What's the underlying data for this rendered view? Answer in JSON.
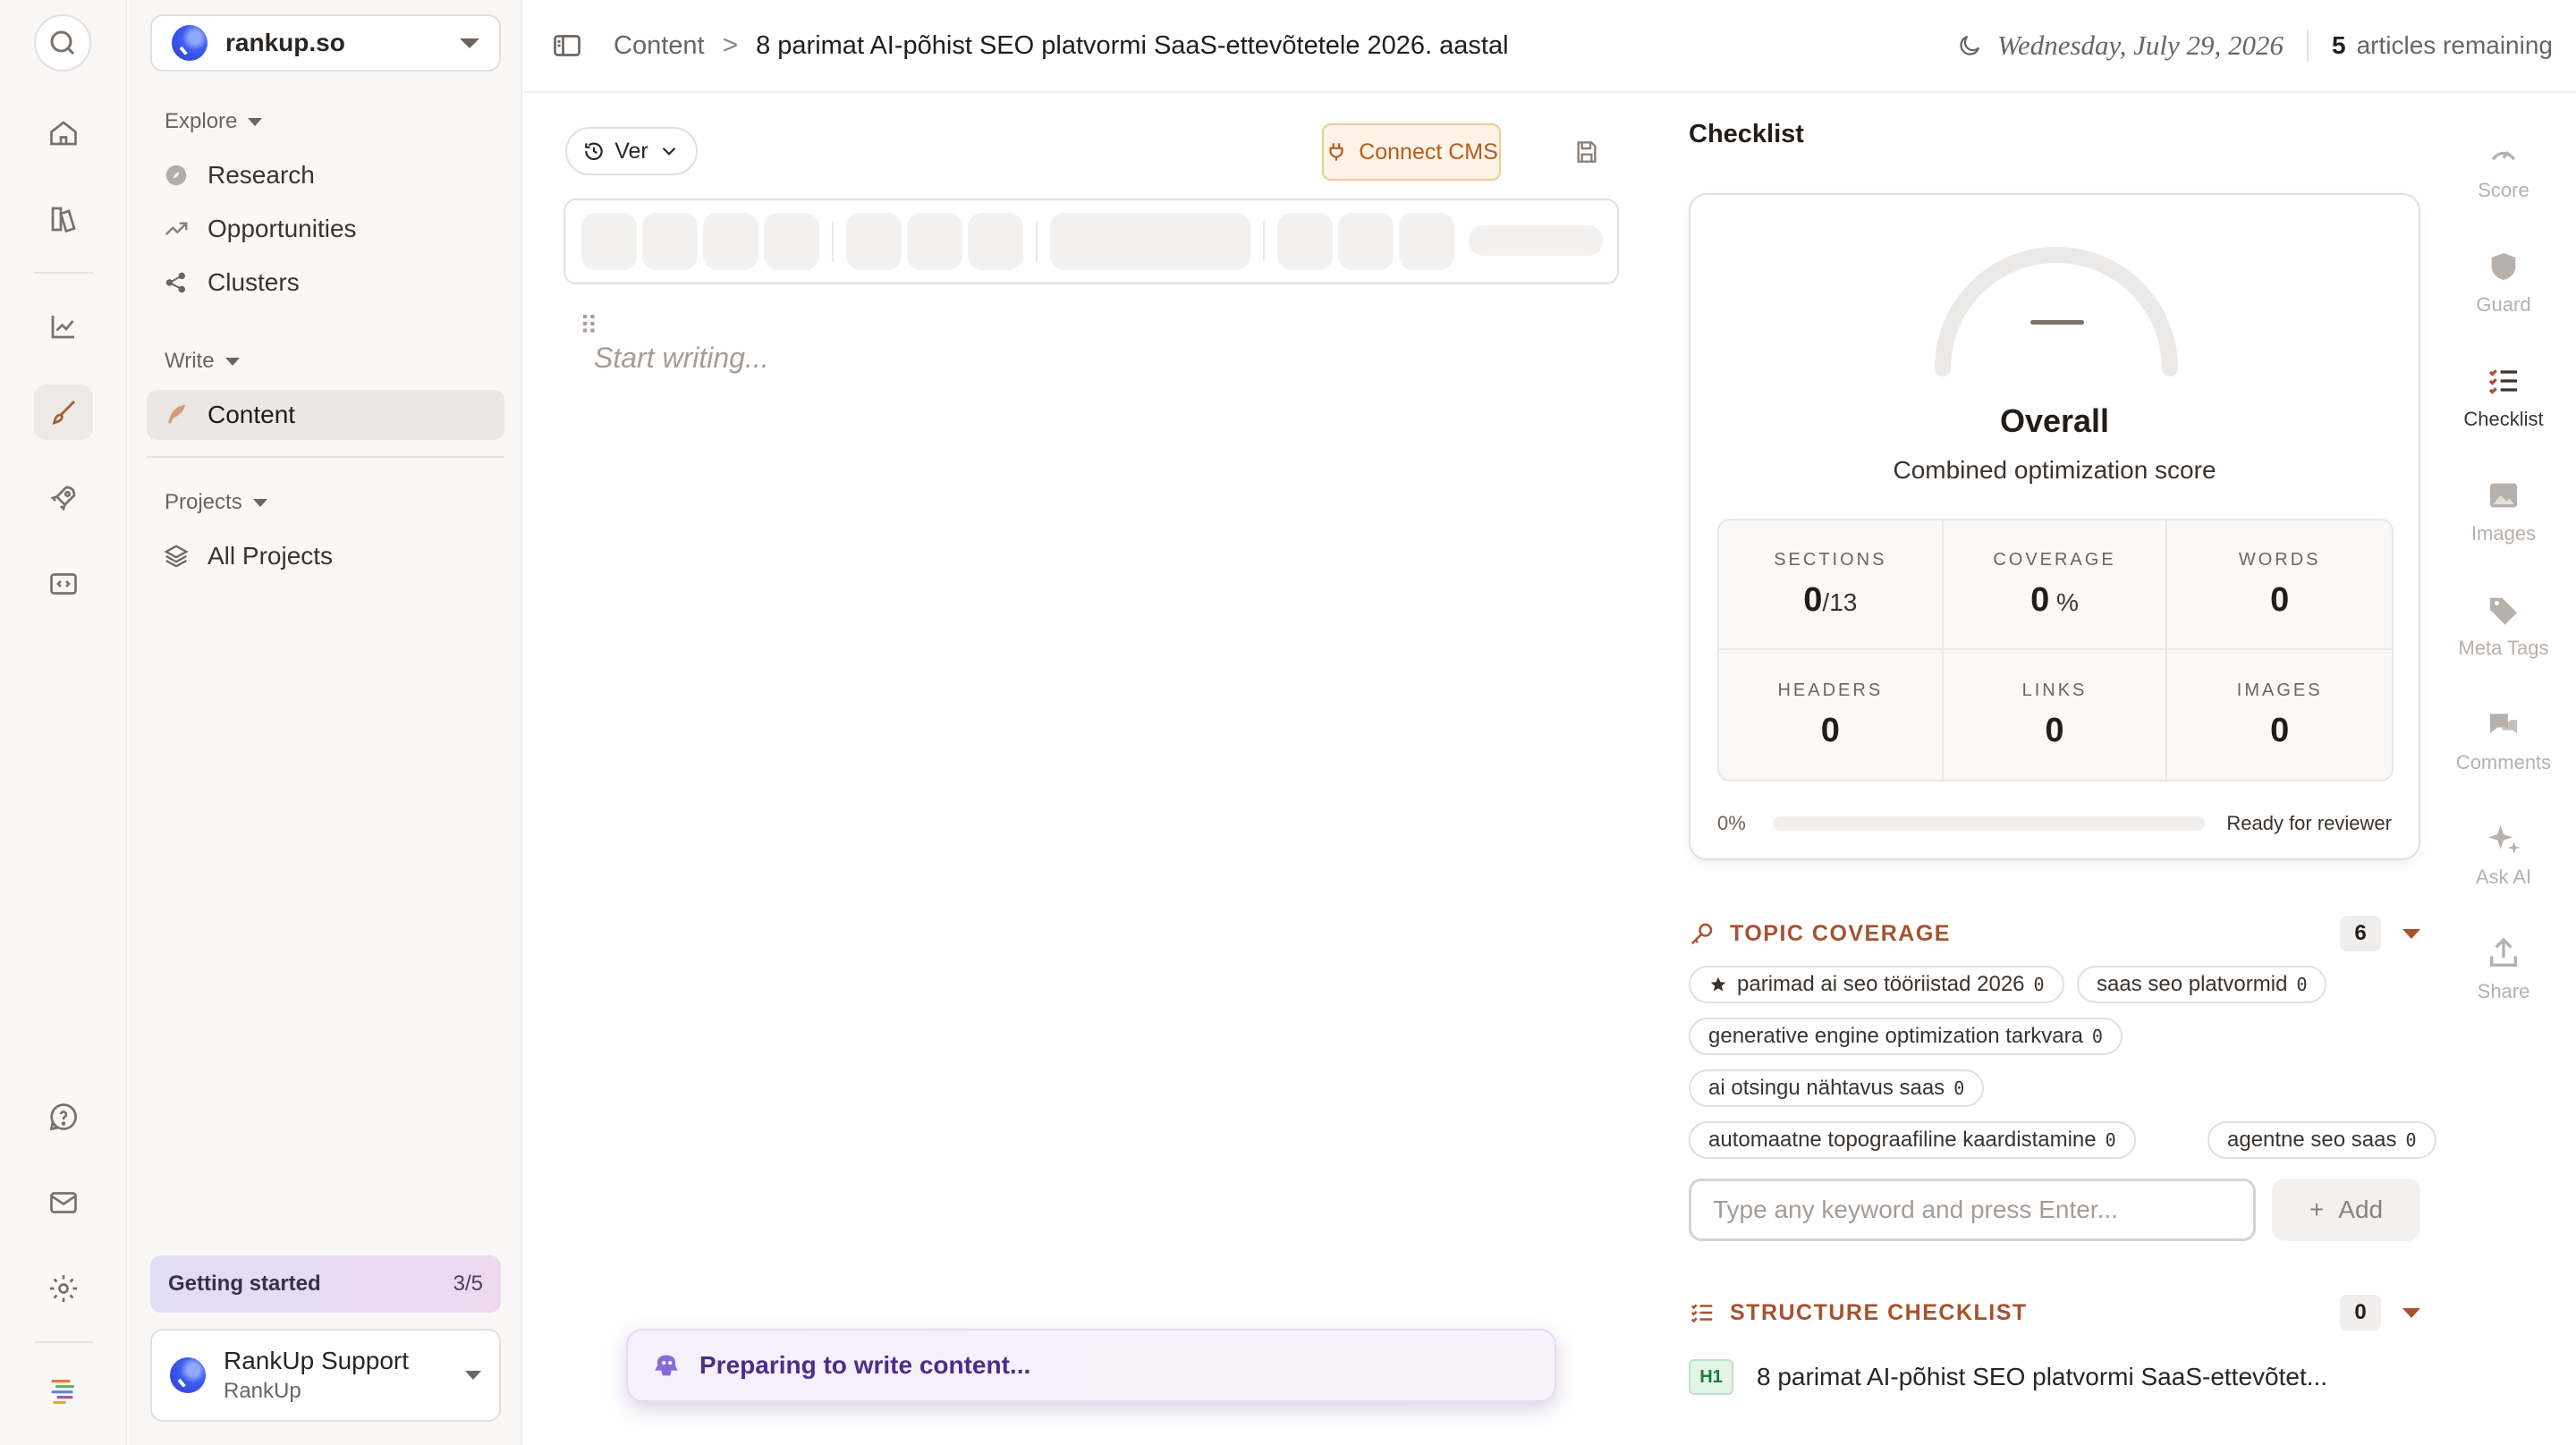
{
  "workspace": {
    "name": "rankup.so"
  },
  "sidebar": {
    "explore_label": "Explore",
    "explore_items": [
      {
        "label": "Research",
        "icon": "compass-icon"
      },
      {
        "label": "Opportunities",
        "icon": "trend-icon"
      },
      {
        "label": "Clusters",
        "icon": "cluster-icon"
      }
    ],
    "write_label": "Write",
    "write_items": [
      {
        "label": "Content",
        "icon": "feather-icon",
        "active": true
      }
    ],
    "projects_label": "Projects",
    "projects_items": [
      {
        "label": "All Projects",
        "icon": "layers-icon"
      }
    ],
    "getting_started": {
      "label": "Getting started",
      "count": "3/5",
      "progress": 0.6
    },
    "support": {
      "name": "RankUp Support",
      "sub": "RankUp"
    }
  },
  "header": {
    "crumb_root": "Content",
    "crumb_sep": ">",
    "title": "8 parimat AI-põhist SEO platvormi SaaS-ettevõtetele 2026. aastal",
    "date": "Wednesday, July 29, 2026",
    "remaining_count": "5",
    "remaining_label": "articles remaining"
  },
  "editor": {
    "version_label": "Ver",
    "connect_cms_label": "Connect CMS",
    "placeholder": "Start writing...",
    "toast": "Preparing to write content..."
  },
  "checklist": {
    "title": "Checklist",
    "overall_score": "—",
    "overall_label": "Overall",
    "overall_sub": "Combined optimization score",
    "stats": [
      {
        "label": "SECTIONS",
        "value": "0",
        "suffix": "/13"
      },
      {
        "label": "COVERAGE",
        "value": "0",
        "suffix": " %"
      },
      {
        "label": "WORDS",
        "value": "0",
        "suffix": ""
      },
      {
        "label": "HEADERS",
        "value": "0",
        "suffix": ""
      },
      {
        "label": "LINKS",
        "value": "0",
        "suffix": ""
      },
      {
        "label": "IMAGES",
        "value": "0",
        "suffix": ""
      }
    ],
    "progress_percent_label": "0%",
    "progress_value": 0,
    "progress_status": "Ready for reviewer",
    "topic_coverage": {
      "title": "TOPIC COVERAGE",
      "count": "6",
      "keywords": [
        {
          "text": "parimad ai seo tööriistad 2026",
          "count": "0",
          "starred": true
        },
        {
          "text": "saas seo platvormid",
          "count": "0"
        },
        {
          "text": "generative engine optimization tarkvara",
          "count": "0"
        },
        {
          "text": "ai otsingu nähtavus saas",
          "count": "0"
        },
        {
          "text": "automaatne topograafiline kaardistamine",
          "count": "0"
        },
        {
          "text": "agentne seo saas",
          "count": "0"
        }
      ],
      "input_placeholder": "Type any keyword and press Enter...",
      "add_label": "Add"
    },
    "structure": {
      "title": "STRUCTURE CHECKLIST",
      "count": "0",
      "items": [
        {
          "level": "H1",
          "text": "8 parimat AI-põhist SEO platvormi SaaS-ettevõtet..."
        }
      ]
    }
  },
  "tools": [
    {
      "label": "Score",
      "icon": "gauge-icon"
    },
    {
      "label": "Guard",
      "icon": "shield-icon"
    },
    {
      "label": "Checklist",
      "icon": "checklist-icon",
      "active": true
    },
    {
      "label": "Images",
      "icon": "image-icon"
    },
    {
      "label": "Meta Tags",
      "icon": "tag-icon"
    },
    {
      "label": "Comments",
      "icon": "comments-icon"
    },
    {
      "label": "Ask AI",
      "icon": "sparkle-icon"
    },
    {
      "label": "Share",
      "icon": "share-icon"
    }
  ],
  "colors": {
    "accent": "#a6522f",
    "cms": "#b35d1e",
    "toast": "#4b2d8a",
    "h1_badge": "#1c7a3c"
  }
}
